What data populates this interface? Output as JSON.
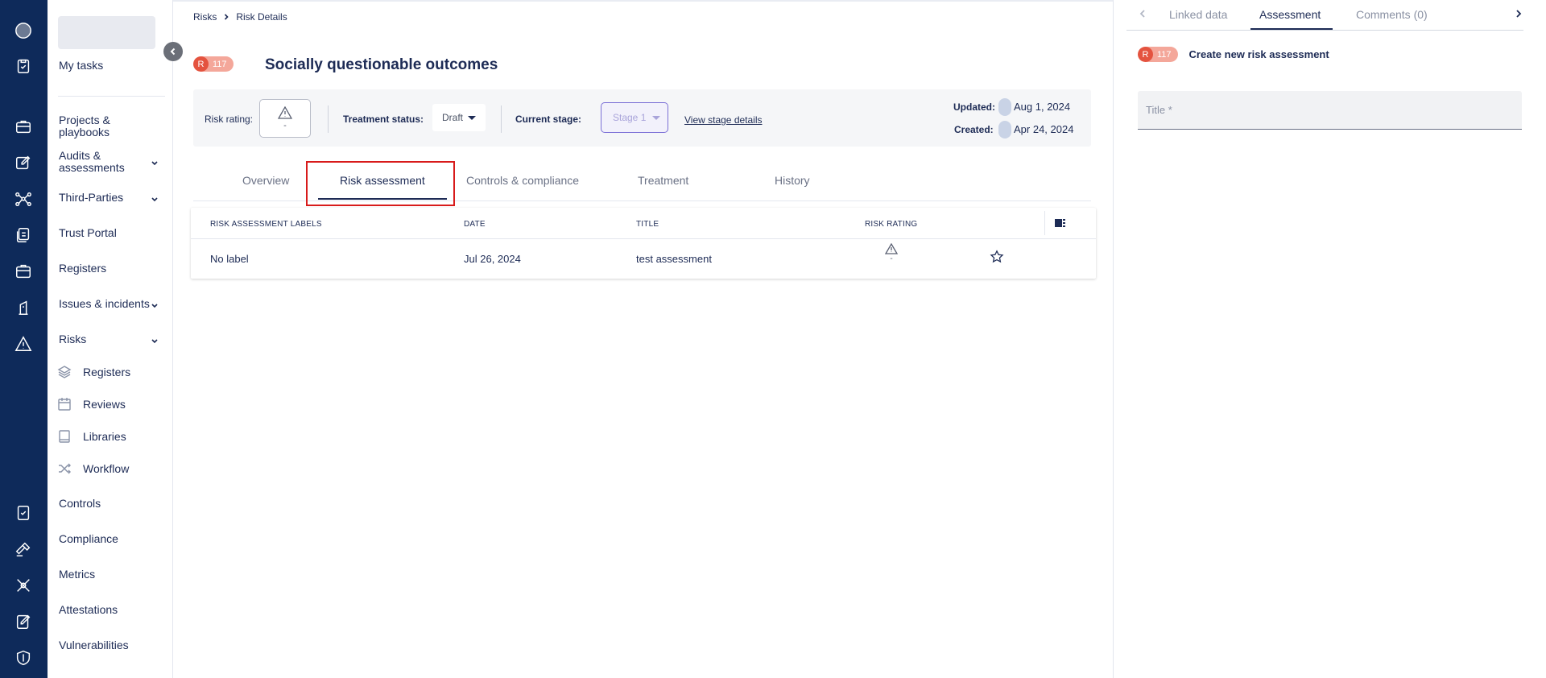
{
  "breadcrumb": {
    "root": "Risks",
    "current": "Risk Details"
  },
  "risk": {
    "badge_letter": "R",
    "badge_number": "117",
    "title": "Socially questionable outcomes"
  },
  "meta": {
    "risk_rating_label": "Risk rating:",
    "risk_rating_value": "-",
    "treatment_status_label": "Treatment status:",
    "treatment_status_value": "Draft",
    "current_stage_label": "Current stage:",
    "current_stage_value": "Stage 1",
    "view_stage_link": "View stage details",
    "updated_label": "Updated:",
    "updated_value": "Aug 1, 2024",
    "created_label": "Created:",
    "created_value": "Apr 24, 2024"
  },
  "tabs": [
    {
      "label": "Overview"
    },
    {
      "label": "Risk assessment"
    },
    {
      "label": "Controls & compliance"
    },
    {
      "label": "Treatment"
    },
    {
      "label": "History"
    }
  ],
  "table": {
    "headers": [
      "RISK ASSESSMENT LABELS",
      "DATE",
      "TITLE",
      "RISK RATING"
    ],
    "rows": [
      {
        "label": "No label",
        "date": "Jul 26, 2024",
        "title": "test assessment",
        "rating": "-"
      }
    ]
  },
  "nav": {
    "my_tasks": "My tasks",
    "projects": "Projects & playbooks",
    "audits": "Audits & assessments",
    "third_parties": "Third-Parties",
    "trust_portal": "Trust Portal",
    "registers": "Registers",
    "issues": "Issues & incidents",
    "risks": "Risks",
    "risks_sub": [
      "Registers",
      "Reviews",
      "Libraries",
      "Workflow"
    ],
    "controls": "Controls",
    "compliance": "Compliance",
    "metrics": "Metrics",
    "attestations": "Attestations",
    "vulnerabilities": "Vulnerabilities"
  },
  "right_panel": {
    "tabs": [
      "Linked data",
      "Assessment",
      "Comments (0)"
    ],
    "heading": "Create new risk assessment",
    "title_placeholder": "Title *"
  },
  "colors": {
    "rail": "#0e2a5a",
    "badge_red": "#e4533f",
    "badge_pink": "#f4a79a",
    "highlight": "#d81b1b",
    "stage_border": "#7b6fd6"
  }
}
